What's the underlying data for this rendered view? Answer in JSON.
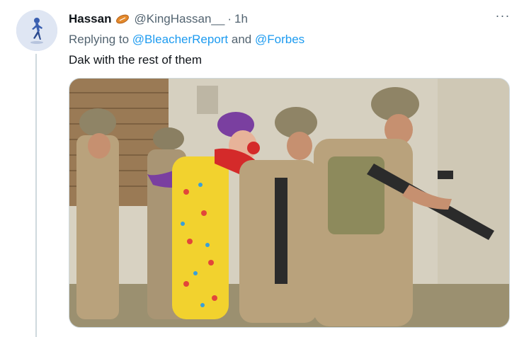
{
  "tweet": {
    "display_name": "Hassan",
    "badge_icon": "football-icon",
    "handle": "@KingHassan__",
    "separator": "·",
    "time": "1h",
    "more_icon": "more-horizontal-icon",
    "more_label": "···",
    "reply": {
      "prefix": "Replying to ",
      "mention_1": "@BleacherReport",
      "conjunction": " and ",
      "mention_2": "@Forbes"
    },
    "text": "Dak with the rest of them",
    "media": {
      "description_icon": "photo-soldiers-and-clown",
      "colors": {
        "wall": "#d8d2c2",
        "bricks": "#9a7a55",
        "uniform": "#b9a27c",
        "clown_wig": "#7a3fa0",
        "clown_suit": "#f2d22e",
        "rifle": "#2b2b2b"
      }
    }
  },
  "colors": {
    "accent": "#1d9bf0",
    "secondary_text": "#536471",
    "thread_line": "#cfd9de"
  }
}
